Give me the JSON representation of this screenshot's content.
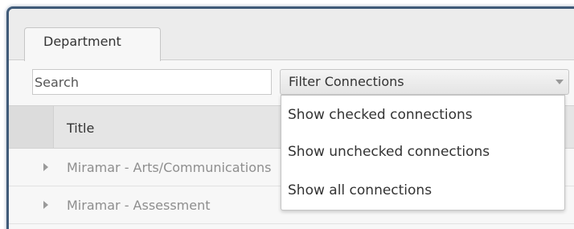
{
  "tabs": [
    {
      "label": "Department"
    }
  ],
  "search": {
    "placeholder": "Search",
    "value": ""
  },
  "filter": {
    "selected": "Filter Connections",
    "options": [
      "Show checked connections",
      "Show unchecked connections",
      "Show all connections"
    ]
  },
  "table": {
    "columns": [
      "Title"
    ],
    "rows": [
      {
        "title": "Miramar - Arts/Communications"
      },
      {
        "title": "Miramar - Assessment"
      }
    ]
  }
}
